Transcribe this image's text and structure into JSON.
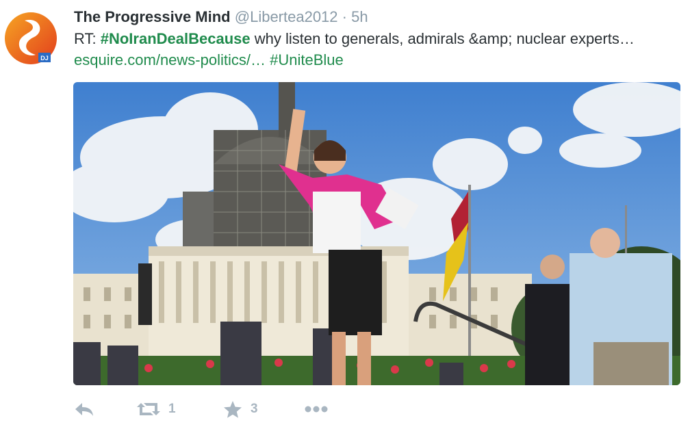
{
  "tweet": {
    "author_name": "The Progressive Mind",
    "author_handle": "@Libertea2012",
    "separator": "·",
    "timestamp": "5h",
    "text_prefix": "RT: ",
    "hashtag_1": "#NoIranDealBecause",
    "text_middle": " why listen to generals, admirals &amp; nuclear experts… ",
    "link": "esquire.com/news-politics/…",
    "hashtag_2": "#UniteBlue",
    "avatar_badge": "DJ"
  },
  "actions": {
    "reply_icon": "reply-icon",
    "retweet_icon": "retweet-icon",
    "retweet_count": "1",
    "favorite_icon": "star-icon",
    "favorite_count": "3",
    "more_icon": "more-dots-icon"
  },
  "colors": {
    "hashtag": "#1f8b4c",
    "handle": "#8899a6",
    "action": "#a9b6c1",
    "avatar_orange": "#f07a1e",
    "avatar_red": "#e23c1d"
  }
}
